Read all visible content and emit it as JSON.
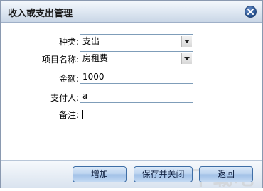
{
  "window": {
    "title": "收入或支出管理"
  },
  "form": {
    "type_label": "种类:",
    "type_value": "支出",
    "item_label": "项目名称:",
    "item_value": "房租费",
    "amount_label": "金额:",
    "amount_value": "1000",
    "payer_label": "支付人:",
    "payer_value": "a",
    "note_label": "备注:",
    "note_value": ""
  },
  "buttons": {
    "add_label": "增加",
    "save_close_label": "保存并关闭",
    "back_label": "返回"
  },
  "watermark": {
    "text": "下载吧"
  },
  "icons": {
    "close": "close-icon",
    "dropdown": "chevron-down-icon"
  }
}
